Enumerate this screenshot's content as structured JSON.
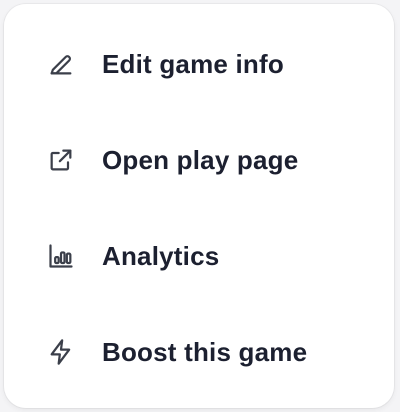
{
  "menu": {
    "items": [
      {
        "label": "Edit game info",
        "icon": "pencil-icon"
      },
      {
        "label": "Open play page",
        "icon": "external-link-icon"
      },
      {
        "label": "Analytics",
        "icon": "bar-chart-icon"
      },
      {
        "label": "Boost this game",
        "icon": "lightning-icon"
      }
    ]
  },
  "colors": {
    "panel": "#ffffff",
    "text": "#1c2030",
    "icon": "#3b3f4a",
    "backdrop": "#f4f4f6"
  }
}
